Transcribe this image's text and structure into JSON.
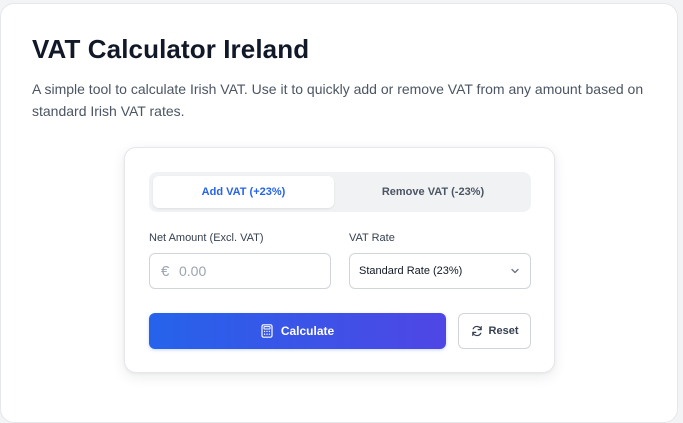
{
  "page": {
    "title": "VAT Calculator Ireland",
    "description": "A simple tool to calculate Irish VAT. Use it to quickly add or remove VAT from any amount based on standard Irish VAT rates."
  },
  "calculator": {
    "tabs": [
      {
        "label": "Add VAT (+23%)",
        "active": true
      },
      {
        "label": "Remove VAT (-23%)",
        "active": false
      }
    ],
    "net_amount": {
      "label": "Net Amount (Excl. VAT)",
      "currency_symbol": "€",
      "placeholder": "0.00",
      "value": ""
    },
    "vat_rate": {
      "label": "VAT Rate",
      "selected": "Standard Rate (23%)"
    },
    "calculate_label": "Calculate",
    "reset_label": "Reset"
  },
  "colors": {
    "accent": "#2563eb",
    "gradient_end": "#4f46e5",
    "title": "#111827",
    "text_muted": "#4b5563"
  },
  "icons": {
    "calculate": "calculator-icon",
    "reset": "refresh-icon",
    "select": "chevron-down-icon"
  }
}
